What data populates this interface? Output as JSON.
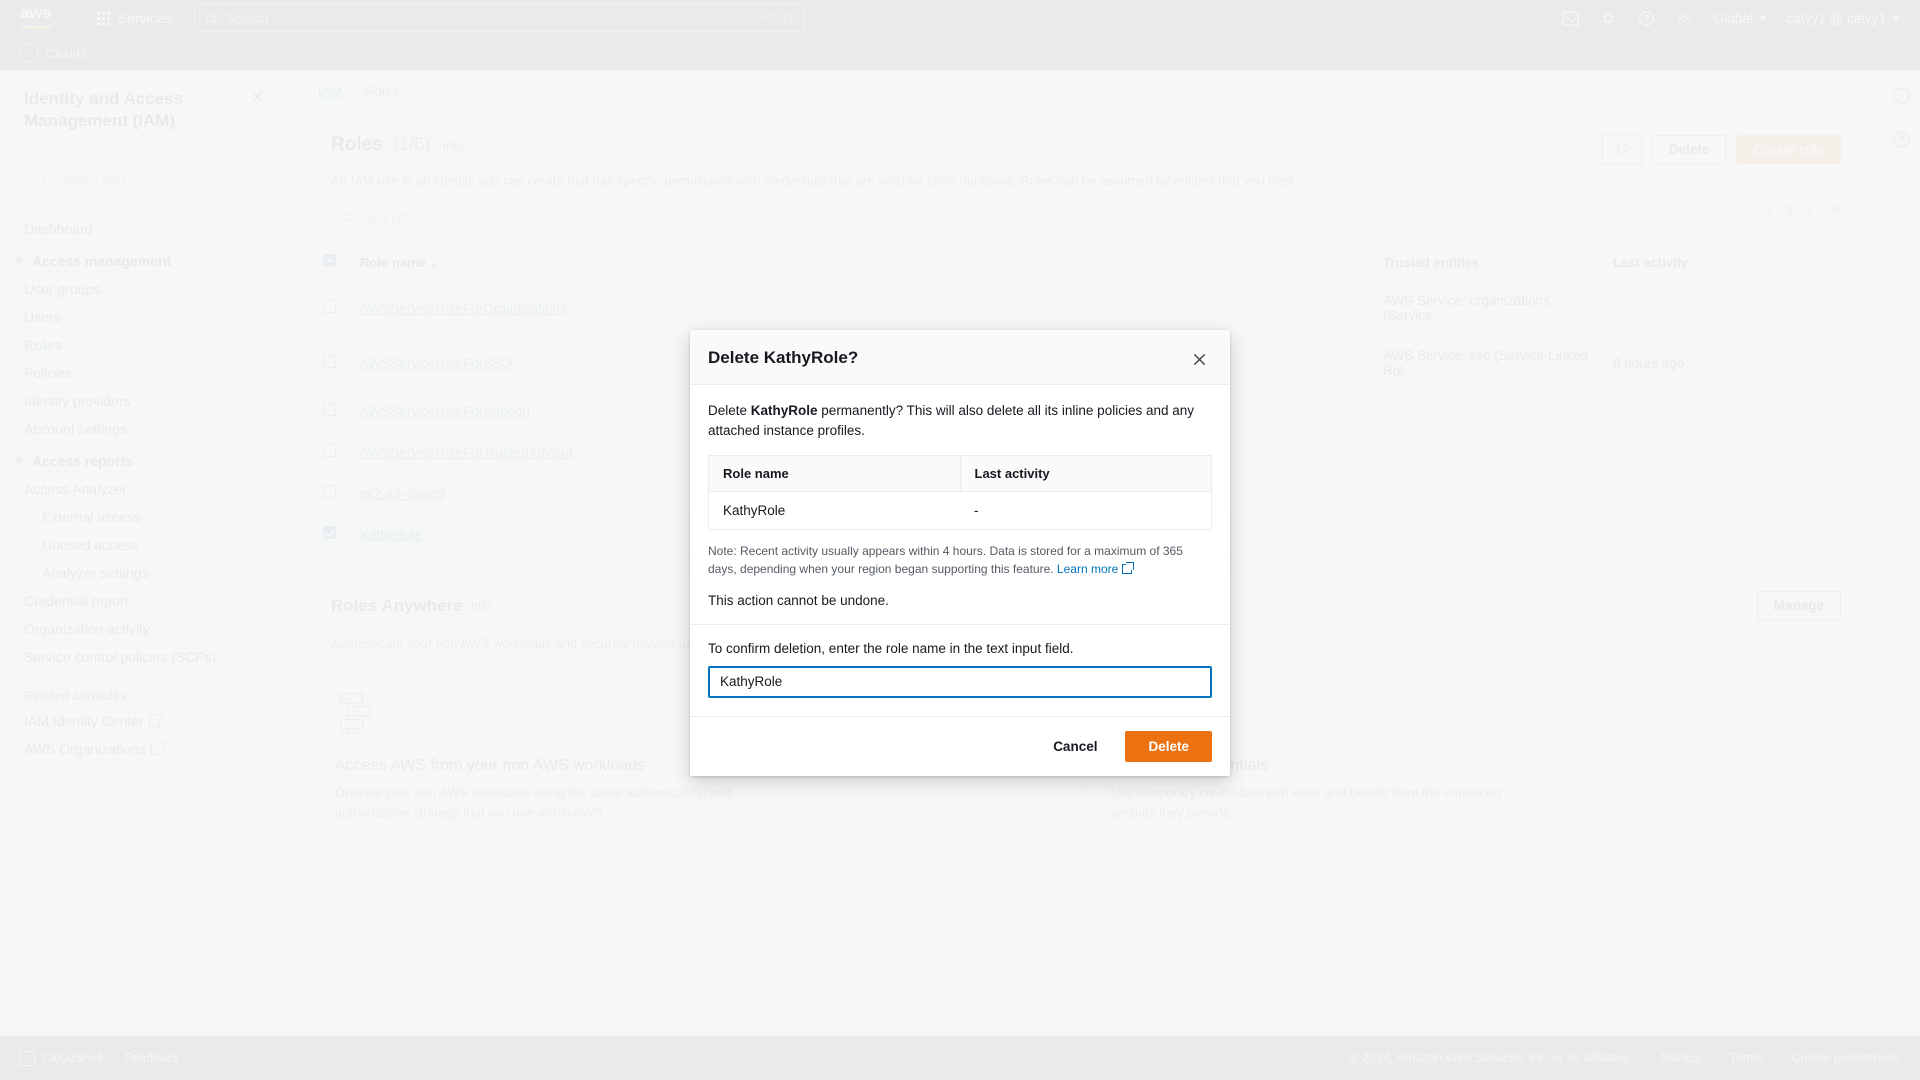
{
  "topnav": {
    "logo_text": "aws",
    "services_label": "Services",
    "search": {
      "placeholder": "Search",
      "shortcut": "[Alt+S]"
    },
    "icons": [
      "cloudshell-icon",
      "bell-icon",
      "help-icon",
      "settings-icon"
    ],
    "region_label": "Global",
    "account_label": "catvy1 @ catvy1"
  },
  "secondary_bar": {
    "app_label": "Cloud9"
  },
  "sidebar": {
    "title": "Identity and Access Management (IAM)",
    "close_label": "✕",
    "search_placeholder": "Search IAM",
    "dashboard_label": "Dashboard",
    "access_management_label": "Access management",
    "access_management_items": [
      "User groups",
      "Users",
      "Roles",
      "Policies",
      "Identity providers",
      "Account settings"
    ],
    "access_reports_label": "Access reports",
    "access_reports_items": [
      "Access Analyzer"
    ],
    "analyzer_sub_items": [
      "External access",
      "Unused access",
      "Analyzer settings"
    ],
    "access_reports_more": [
      "Credential report",
      "Organization activity",
      "Service control policies (SCPs)"
    ],
    "related_consoles_label": "Related consoles",
    "related_consoles": [
      "IAM Identity Center",
      "AWS Organizations"
    ]
  },
  "breadcrumb": {
    "root": "IAM",
    "sep": "›",
    "current": "Roles"
  },
  "roles_panel": {
    "title": "Roles",
    "count": "(1/6)",
    "info_label": "Info",
    "description": "An IAM role is an identity you can create that has specific permissions with credentials that are valid for short durations. Roles can be assumed by entities that you trust.",
    "refresh_icon": "refresh-icon",
    "delete_label": "Delete",
    "create_label": "Create role",
    "search_placeholder": "Search",
    "page_number": "1",
    "columns": [
      "Role name",
      "Trusted entities",
      "Last activity"
    ],
    "rows": [
      {
        "selected": false,
        "name": "AWSServiceRoleForOrganizations",
        "trusted": "AWS Service: organizations (Service-",
        "activity": "-"
      },
      {
        "selected": false,
        "name": "AWSServiceRoleForSSO",
        "trusted": "AWS Service: sso (Service-Linked Rol",
        "activity": "8 hours ago"
      },
      {
        "selected": false,
        "name": "AWSServiceRoleForSupport",
        "trusted": "",
        "activity": ""
      },
      {
        "selected": false,
        "name": "AWSServiceRoleForTrustedAdvisor",
        "trusted": "",
        "activity": ""
      },
      {
        "selected": false,
        "name": "ec2-s3-control",
        "trusted": "",
        "activity": ""
      },
      {
        "selected": true,
        "name": "KathyRole",
        "trusted": "",
        "activity": ""
      }
    ]
  },
  "roles_anywhere": {
    "title": "Roles Anywhere",
    "info_label": "Info",
    "description": "Authenticate your non AWS workloads and securely provide access to AWS services using X.509 certificates from your Private",
    "manage_label": "Manage",
    "cards": [
      {
        "icon": "servers-icon",
        "heading": "Access AWS from your non AWS workloads",
        "text": "Operate your non AWS workloads using the same authentication and authorization strategy that you use within AWS."
      },
      {
        "icon": "temporary-credentials-icon",
        "heading": "Temporary credentials",
        "text": "Use temporary credentials with ease and benefit from the enhanced security they provide."
      }
    ]
  },
  "footer": {
    "cloudshell_label": "CloudShell",
    "feedback_label": "Feedback",
    "copyright": "© 2024, Amazon Web Services, Inc. or its affiliates.",
    "links": [
      "Privacy",
      "Terms",
      "Cookie preferences"
    ]
  },
  "modal": {
    "title": "Delete KathyRole?",
    "close_icon": "close-icon",
    "body_prefix": "Delete ",
    "role_name_bold": "KathyRole",
    "body_suffix": " permanently? This will also delete all its inline policies and any attached instance profiles.",
    "table": {
      "columns": [
        "Role name",
        "Last activity"
      ],
      "row": {
        "role_name": "KathyRole",
        "last_activity": "-"
      }
    },
    "note": "Note: Recent activity usually appears within 4 hours. Data is stored for a maximum of 365 days, depending when your region began supporting this feature.",
    "note_link": "Learn more",
    "undone_text": "This action cannot be undone.",
    "confirm_label": "To confirm deletion, enter the role name in the text input field.",
    "input_value": "KathyRole",
    "input_placeholder": "",
    "cancel_label": "Cancel",
    "delete_label": "Delete",
    "accent_color": "#ec7211",
    "focus_color": "#0073bb"
  }
}
